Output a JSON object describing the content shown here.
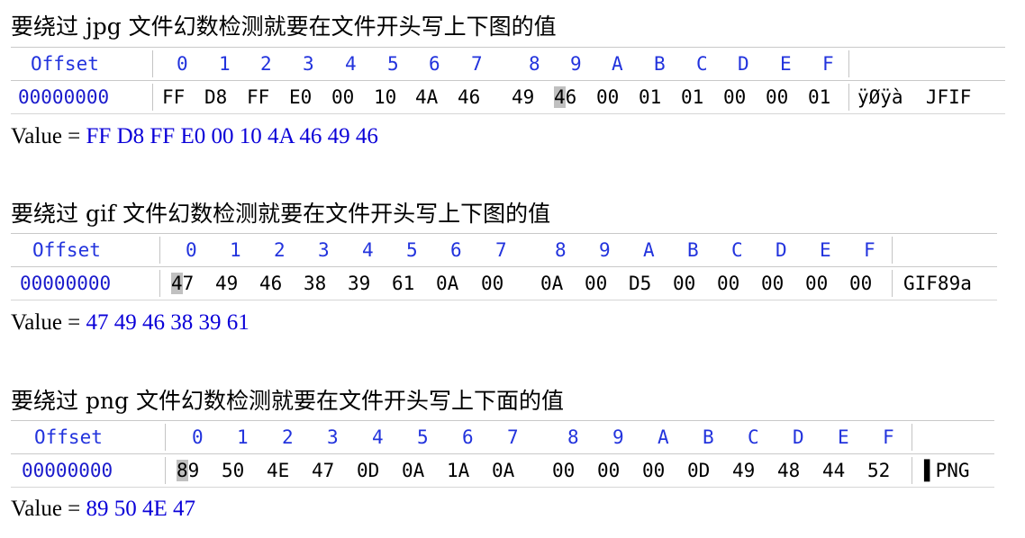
{
  "sections": [
    {
      "heading": "要绕过 jpg 文件幻数检测就要在文件开头写上下图的值",
      "hex": {
        "offset_header": "Offset",
        "columns": [
          "0",
          "1",
          "2",
          "3",
          "4",
          "5",
          "6",
          "7",
          "8",
          "9",
          "A",
          "B",
          "C",
          "D",
          "E",
          "F"
        ],
        "offset": "00000000",
        "bytes": [
          "FF",
          "D8",
          "FF",
          "E0",
          "00",
          "10",
          "4A",
          "46",
          "49",
          "46",
          "00",
          "01",
          "01",
          "00",
          "00",
          "01"
        ],
        "ascii": "ÿØÿà  JFIF"
      },
      "value_label": "Value = ",
      "value_hex": "FF D8 FF E0 00 10 4A 46 49 46"
    },
    {
      "heading": "要绕过 gif 文件幻数检测就要在文件开头写上下图的值",
      "hex": {
        "offset_header": "Offset",
        "columns": [
          "0",
          "1",
          "2",
          "3",
          "4",
          "5",
          "6",
          "7",
          "8",
          "9",
          "A",
          "B",
          "C",
          "D",
          "E",
          "F"
        ],
        "offset": "00000000",
        "bytes": [
          "47",
          "49",
          "46",
          "38",
          "39",
          "61",
          "0A",
          "00",
          "0A",
          "00",
          "D5",
          "00",
          "00",
          "00",
          "00",
          "00"
        ],
        "ascii": "GIF89a"
      },
      "value_label": "Value = ",
      "value_hex": "47 49 46 38 39 61"
    },
    {
      "heading": "要绕过 png 文件幻数检测就要在文件开头写上下面的值",
      "hex": {
        "offset_header": "Offset",
        "columns": [
          "0",
          "1",
          "2",
          "3",
          "4",
          "5",
          "6",
          "7",
          "8",
          "9",
          "A",
          "B",
          "C",
          "D",
          "E",
          "F"
        ],
        "offset": "00000000",
        "bytes": [
          "89",
          "50",
          "4E",
          "47",
          "0D",
          "0A",
          "1A",
          "0A",
          "00",
          "00",
          "00",
          "0D",
          "49",
          "48",
          "44",
          "52"
        ],
        "ascii": "▌PNG"
      },
      "value_label": "Value = ",
      "value_hex": "89 50 4E 47"
    }
  ]
}
